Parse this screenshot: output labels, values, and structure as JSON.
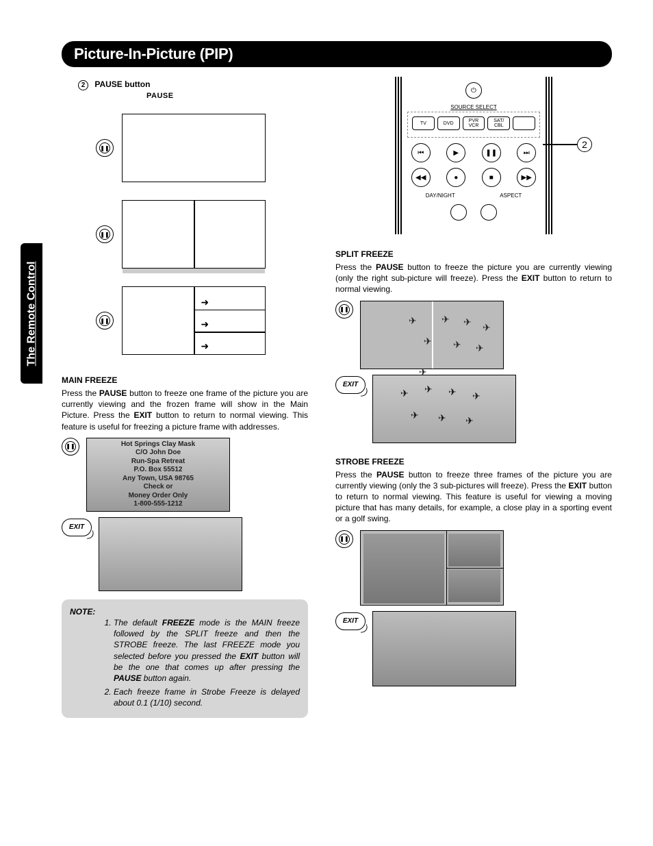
{
  "sideTab": "The Remote Control",
  "title": "Picture-In-Picture (PIP)",
  "stepNum": "2",
  "pauseButton": "PAUSE button",
  "pauseSub": "PAUSE",
  "mainFreeze": {
    "heading": "MAIN FREEZE",
    "p1a": "Press the ",
    "p1b": "PAUSE",
    "p1c": " button to freeze one frame of the picture you are currently viewing and the frozen frame will show in the Main Picture.  Press the ",
    "p1d": "EXIT",
    "p1e": " button to return to normal viewing.  This feature is useful for freezing a picture frame with addresses.",
    "overlay": {
      "l1": "Hot Springs Clay Mask",
      "l2": "C/O John Doe",
      "l3": "Run-Spa Retreat",
      "l4": "P.O. Box 55512",
      "l5": "Any Town, USA 98765",
      "l6": "Check or",
      "l7": "Money Order Only",
      "l8": "1-800-555-1212"
    }
  },
  "exitLabel": "EXIT",
  "note": {
    "label": "NOTE:",
    "n1a": "The default ",
    "n1b": "FREEZE",
    "n1c": " mode is the MAIN freeze followed by the SPLIT freeze and then the STROBE freeze.  The last FREEZE mode you selected before you pressed the ",
    "n1d": "EXIT",
    "n1e": " button will be the one that comes up after pressing the ",
    "n1f": "PAUSE",
    "n1g": " button again.",
    "n2": "Each freeze frame in Strobe Freeze is delayed about 0.1 (1/10) second."
  },
  "remote": {
    "sourceSelect": "SOURCE SELECT",
    "tv": "TV",
    "dvd": "DVD",
    "pvr": "PVR\nVCR",
    "sat": "SAT/\nCBL",
    "dayNight": "DAY/NIGHT",
    "aspect": "ASPECT",
    "callout": "2"
  },
  "splitFreeze": {
    "heading": "SPLIT FREEZE",
    "a": "Press the ",
    "b": "PAUSE",
    "c": " button to freeze the picture you are currently viewing (only the right sub-picture will freeze).  Press the ",
    "d": "EXIT",
    "e": " button to return to normal viewing."
  },
  "strobeFreeze": {
    "heading": "STROBE FREEZE",
    "a": "Press the ",
    "b": "PAUSE",
    "c": " button to freeze three frames of the picture you are currently viewing (only the 3 sub-pictures will freeze). Press the ",
    "d": "EXIT",
    "e": " button to return to normal viewing. This feature is useful for viewing a moving picture that has many details, for example, a close play in a sporting event or a golf swing."
  }
}
